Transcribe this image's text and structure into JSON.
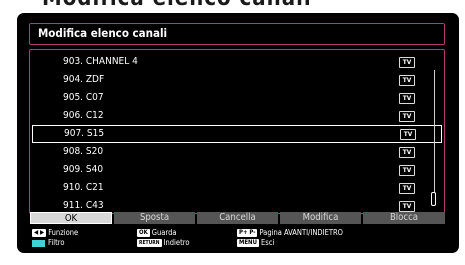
{
  "top_fragment": "Modifica elenco canali",
  "title": "Modifica elenco canali",
  "channels": [
    {
      "label": "903. CHANNEL 4",
      "type": "TV"
    },
    {
      "label": "904. ZDF",
      "type": "TV"
    },
    {
      "label": "905. C07",
      "type": "TV"
    },
    {
      "label": "906. C12",
      "type": "TV"
    },
    {
      "label": "907. S15",
      "type": "TV",
      "selected": true
    },
    {
      "label": "908. S20",
      "type": "TV"
    },
    {
      "label": "909. S40",
      "type": "TV"
    },
    {
      "label": "910. C21",
      "type": "TV"
    },
    {
      "label": "911. C43",
      "type": "TV"
    }
  ],
  "scroll_position": 0.95,
  "buttons": {
    "ok": "OK",
    "sposta": "Sposta",
    "cancella": "Cancella",
    "modifica": "Modifica",
    "blocca": "Blocca"
  },
  "help": {
    "nav_key": "◀ ▶",
    "nav_label": "Funzione",
    "filter_label": "Filtro",
    "ok_key": "OK",
    "ok_label": "Guarda",
    "back_key": "RETURN",
    "back_label": "Indietro",
    "page_key": "P+ P-",
    "page_label": "Pagina AVANTI/INDIETRO",
    "menu_key": "MENU",
    "menu_label": "Esci"
  },
  "colors": {
    "frame_border": "#b23a78",
    "filter_key": "#3fd3d6",
    "active_button": "#d8d8d8",
    "inactive_button": "#555555"
  }
}
